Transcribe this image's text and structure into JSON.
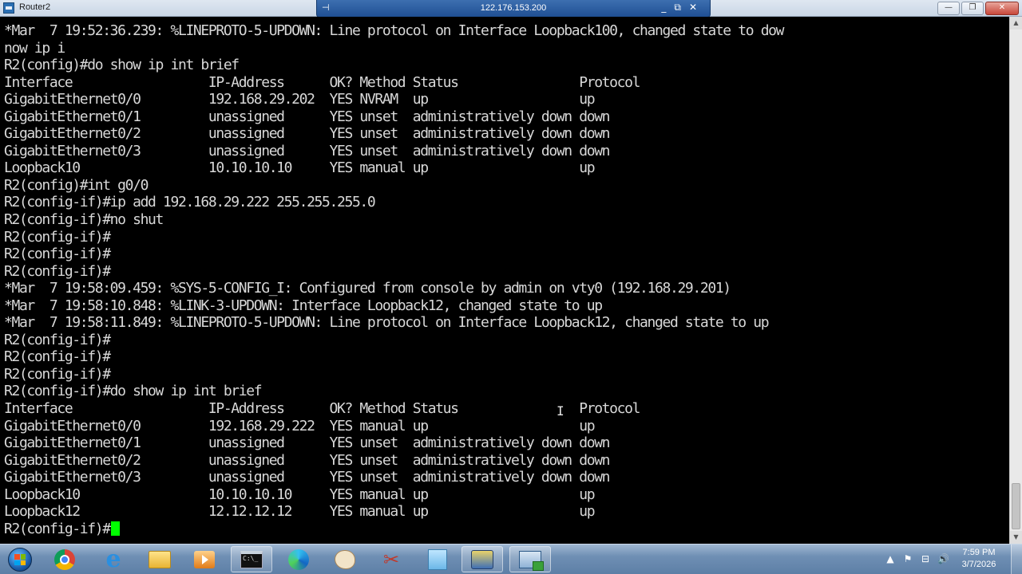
{
  "window": {
    "title": "Router2",
    "minimize_label": "—",
    "restore_label": "❐",
    "close_label": "✕"
  },
  "remote_bar": {
    "host": "122.176.153.200",
    "pin_icon": "⊣",
    "minimize_label": "_",
    "restore_label": "⧉",
    "close_label": "✕"
  },
  "terminal": {
    "lines": [
      "*Mar  7 19:52:36.239: %LINEPROTO-5-UPDOWN: Line protocol on Interface Loopback100, changed state to dow",
      "now ip i",
      "R2(config)#do show ip int brief",
      "Interface                  IP-Address      OK? Method Status                Protocol",
      "GigabitEthernet0/0         192.168.29.202  YES NVRAM  up                    up",
      "GigabitEthernet0/1         unassigned      YES unset  administratively down down",
      "GigabitEthernet0/2         unassigned      YES unset  administratively down down",
      "GigabitEthernet0/3         unassigned      YES unset  administratively down down",
      "Loopback10                 10.10.10.10     YES manual up                    up",
      "R2(config)#int g0/0",
      "R2(config-if)#ip add 192.168.29.222 255.255.255.0",
      "R2(config-if)#no shut",
      "R2(config-if)#",
      "R2(config-if)#",
      "R2(config-if)#",
      "*Mar  7 19:58:09.459: %SYS-5-CONFIG_I: Configured from console by admin on vty0 (192.168.29.201)",
      "*Mar  7 19:58:10.848: %LINK-3-UPDOWN: Interface Loopback12, changed state to up",
      "*Mar  7 19:58:11.849: %LINEPROTO-5-UPDOWN: Line protocol on Interface Loopback12, changed state to up",
      "R2(config-if)#",
      "R2(config-if)#",
      "R2(config-if)#",
      "R2(config-if)#do show ip int brief",
      "Interface                  IP-Address      OK? Method Status                Protocol",
      "GigabitEthernet0/0         192.168.29.222  YES manual up                    up",
      "GigabitEthernet0/1         unassigned      YES unset  administratively down down",
      "GigabitEthernet0/2         unassigned      YES unset  administratively down down",
      "GigabitEthernet0/3         unassigned      YES unset  administratively down down",
      "Loopback10                 10.10.10.10     YES manual up                    up",
      "Loopback12                 12.12.12.12     YES manual up                    up"
    ],
    "prompt": "R2(config-if)#",
    "cursor_color": "#00ff00",
    "text_color": "#d8d8d8",
    "background_color": "#000000"
  },
  "scrollbar": {
    "up_arrow": "▲",
    "down_arrow": "▼"
  },
  "taskbar": {
    "start_icon": "windows-start-orb",
    "pinned": [
      {
        "name": "chrome-icon"
      },
      {
        "name": "internet-explorer-icon",
        "glyph": "e"
      },
      {
        "name": "file-explorer-icon"
      },
      {
        "name": "media-player-icon"
      },
      {
        "name": "command-prompt-icon",
        "glyph": "C:\\_"
      },
      {
        "name": "edge-icon"
      },
      {
        "name": "paint-icon"
      },
      {
        "name": "snipping-tool-icon",
        "glyph": "✂"
      },
      {
        "name": "notepad-icon"
      },
      {
        "name": "network-tool-icon"
      },
      {
        "name": "remote-desktop-icon"
      }
    ],
    "tray": {
      "expand_icon": "▲",
      "flag_icon": "⚑",
      "network_icon": "⊟",
      "volume_icon": "🔊",
      "time": "7:59 PM",
      "date": "3/7/2026"
    }
  }
}
